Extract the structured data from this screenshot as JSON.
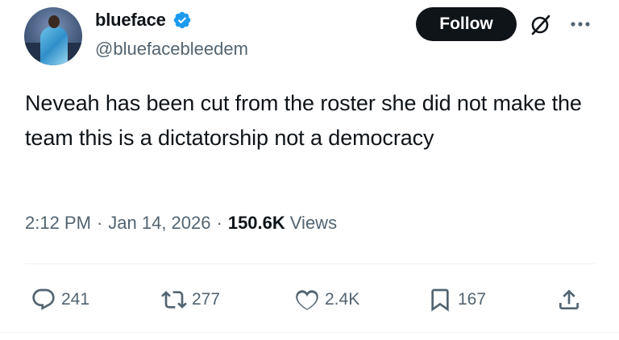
{
  "user": {
    "display_name": "blueface",
    "handle": "@bluefacebleedem",
    "verified": true
  },
  "header": {
    "follow_label": "Follow",
    "icons": [
      "grok-icon",
      "more-options-icon"
    ]
  },
  "tweet": {
    "text": "Neveah has been cut from the roster she did not make the team this is a dictatorship not a democracy",
    "time": "2:12 PM",
    "separator": "·",
    "date": "Jan 14, 2026",
    "views_count": "150.6K",
    "views_label": "Views"
  },
  "actions": {
    "reply_count": "241",
    "retweet_count": "277",
    "like_count": "2.4K",
    "bookmark_count": "167"
  },
  "colors": {
    "text_primary": "#0f1419",
    "text_secondary": "#536471",
    "verified_blue": "#1d9bf0",
    "follow_bg": "#0f1419",
    "divider": "#eff3f4"
  }
}
